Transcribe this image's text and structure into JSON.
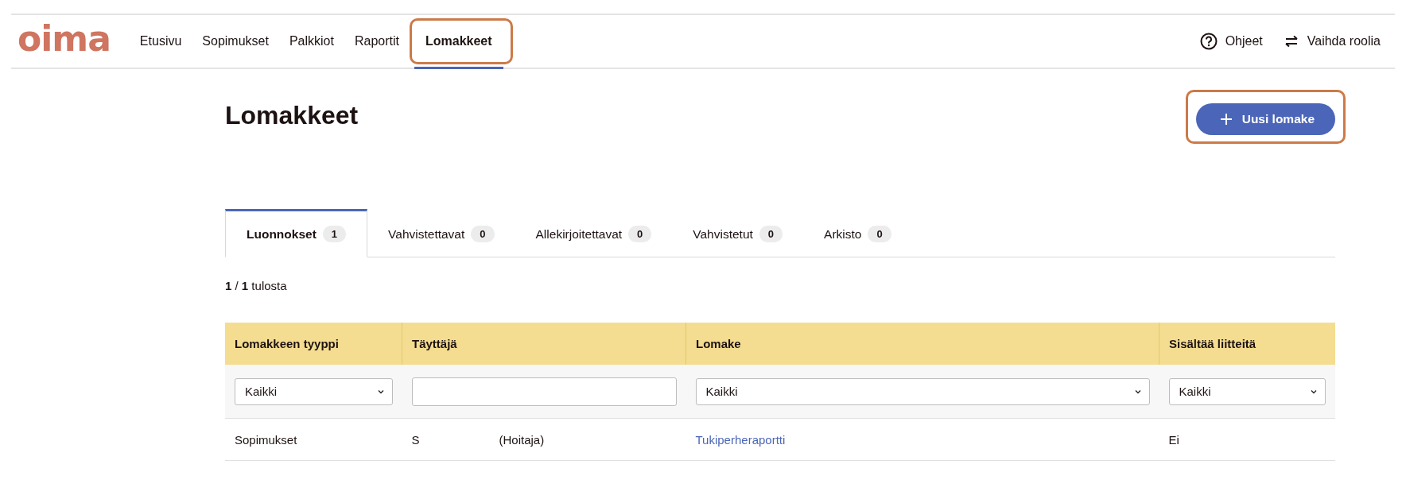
{
  "header": {
    "logo": "oima",
    "nav": [
      {
        "label": "Etusivu",
        "selected": false,
        "highlighted": false
      },
      {
        "label": "Sopimukset",
        "selected": false,
        "highlighted": false
      },
      {
        "label": "Palkkiot",
        "selected": false,
        "highlighted": false
      },
      {
        "label": "Raportit",
        "selected": false,
        "highlighted": false
      },
      {
        "label": "Lomakkeet",
        "selected": true,
        "highlighted": true
      }
    ],
    "actions": [
      {
        "kind": "help",
        "label": "Ohjeet"
      },
      {
        "kind": "switch",
        "label": "Vaihda roolia"
      }
    ]
  },
  "page": {
    "title": "Lomakkeet",
    "new_button": {
      "label": "Uusi lomake",
      "highlighted": true
    }
  },
  "tabs": [
    {
      "label": "Luonnokset",
      "count": "1",
      "selected": true
    },
    {
      "label": "Vahvistettavat",
      "count": "0",
      "selected": false
    },
    {
      "label": "Allekirjoitettavat",
      "count": "0",
      "selected": false
    },
    {
      "label": "Vahvistetut",
      "count": "0",
      "selected": false
    },
    {
      "label": "Arkisto",
      "count": "0",
      "selected": false
    }
  ],
  "result_count": "**1** / **1** tulosta",
  "table": {
    "columns": [
      "Lomakkeen tyyppi",
      "Täyttäjä",
      "Lomake",
      "Sisältää liitteitä"
    ],
    "filters": [
      {
        "kind": "select",
        "value": "Kaikki"
      },
      {
        "kind": "text"
      },
      {
        "kind": "select",
        "value": "Kaikki"
      },
      {
        "kind": "select",
        "value": "Kaikki"
      }
    ],
    "rows": [
      {
        "type": "Sopimukset",
        "filler": [
          "S",
          "(Hoitaja)"
        ],
        "form": "Tukiperheraportti",
        "attachments": "Ei"
      }
    ]
  }
}
